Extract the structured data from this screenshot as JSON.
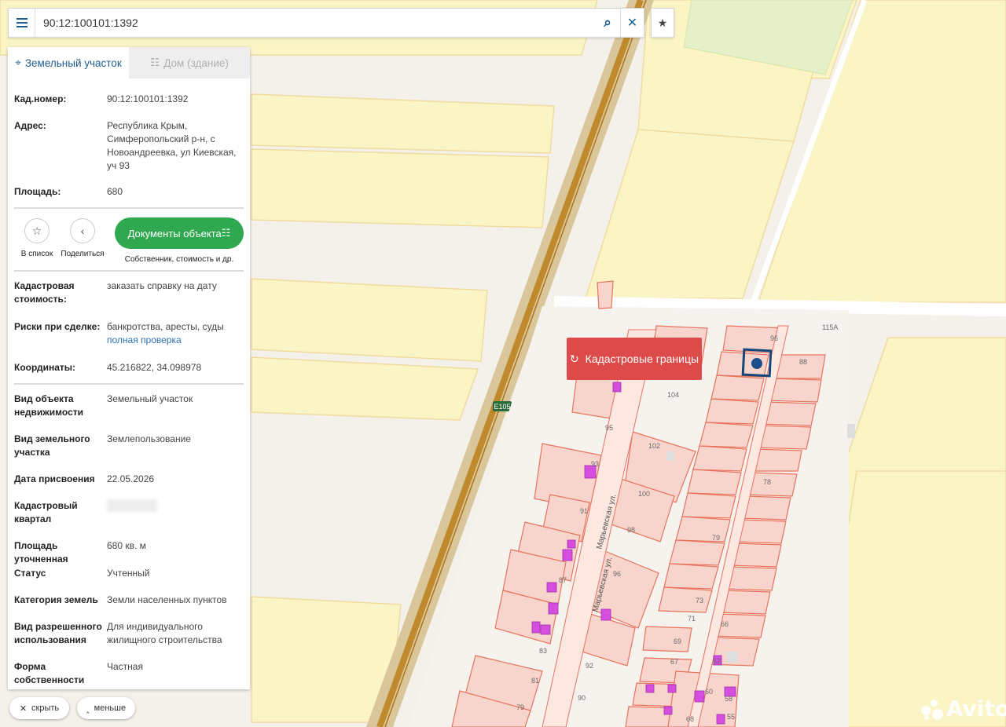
{
  "search": {
    "query": "90:12:100101:1392"
  },
  "tabs": [
    {
      "label": "Земельный участок"
    },
    {
      "label": "Дом (здание)"
    }
  ],
  "info_top": [
    {
      "label": "Кад.номер:",
      "value": "90:12:100101:1392"
    },
    {
      "label": "Адрес:",
      "value": "Республика Крым, Симферопольский р-н, с Новоандреевка, ул Киевская, уч 93"
    },
    {
      "label": "Площадь:",
      "value": "680"
    }
  ],
  "actions": {
    "favorite": "В список",
    "share": "Поделиться",
    "docs_button": "Документы объекта",
    "docs_caption": "Собственник, стоимость и др."
  },
  "info_mid": {
    "cost_label": "Кадастровая стоимость:",
    "cost_link": "заказать справку на дату",
    "risks_label": "Риски при сделке:",
    "risks_value": "банкротства, аресты, суды",
    "risks_link": "полная проверка",
    "coords_label": "Координаты:",
    "coords_value": "45.216822, 34.098978"
  },
  "info_bottom": [
    {
      "label": "Вид объекта недвижимости",
      "value": "Земельный участок"
    },
    {
      "label": "Вид земельного участка",
      "value": "Землепользование"
    },
    {
      "label": "Дата присвоения",
      "value": "22.05.2026"
    },
    {
      "label": "Кадастровый квартал",
      "value": ""
    },
    {
      "label": "Площадь уточненная",
      "value": "680 кв. м"
    },
    {
      "label": "Статус",
      "value": "Учтенный"
    },
    {
      "label": "Категория земель",
      "value": "Земли населенных пунктов"
    },
    {
      "label": "Вид разрешенного использования",
      "value": "Для индивидуального жилищного строительства"
    },
    {
      "label": "Форма собственности",
      "value": "Частная"
    }
  ],
  "bottom_buttons": {
    "hide": "скрыть",
    "less": "меньше"
  },
  "map": {
    "cadastral_button": "Кадастровые границы",
    "road_label": "E105",
    "street_labels": [
      "Марьевская ул.",
      "Марьевская ул."
    ],
    "parcel_numbers": [
      "96",
      "115А",
      "88",
      "104",
      "95",
      "102",
      "93",
      "100",
      "78",
      "91",
      "98",
      "79",
      "96",
      "87",
      "73",
      "71",
      "66",
      "69",
      "83",
      "67",
      "92",
      "62",
      "81",
      "90",
      "60",
      "79",
      "58",
      "55",
      "68"
    ],
    "watermark": "Avito"
  },
  "colors": {
    "field": "#fbf5c6",
    "field_border": "#f1dca0",
    "parcel": "#f8d5cc",
    "parcel_border": "#e7735e",
    "building": "#d54ee0",
    "road": "#c08a2c",
    "accent": "#1c5d8f",
    "green": "#2fa84f",
    "red": "#dc4a4a"
  },
  "icons": [
    "menu-icon",
    "search-icon",
    "close-icon",
    "star-icon",
    "map-pin-icon",
    "building-icon",
    "share-icon",
    "document-icon",
    "refresh-icon"
  ]
}
